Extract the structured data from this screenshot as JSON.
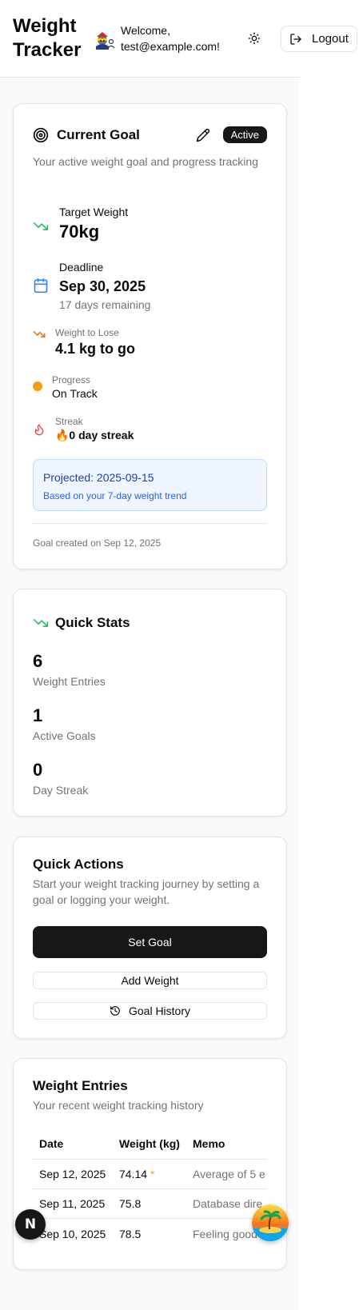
{
  "header": {
    "app_title": "Weight Tracker",
    "welcome_line1": "Welcome,",
    "welcome_line2": "test@example.com!",
    "logout_label": "Logout"
  },
  "current_goal": {
    "title": "Current Goal",
    "badge": "Active",
    "description": "Your active weight goal and progress tracking",
    "target_label": "Target Weight",
    "target_value": "70kg",
    "deadline_label": "Deadline",
    "deadline_value": "Sep 30, 2025",
    "days_remaining": "17 days remaining",
    "to_lose_label": "Weight to Lose",
    "to_lose_value": "4.1 kg to go",
    "progress_label": "Progress",
    "progress_value": "On Track",
    "streak_label": "Streak",
    "streak_value": "🔥0 day streak",
    "projection_title": "Projected: 2025-09-15",
    "projection_note": "Based on your 7-day weight trend",
    "created_note": "Goal created on Sep 12, 2025"
  },
  "quick_stats": {
    "title": "Quick Stats",
    "stats": [
      {
        "value": "6",
        "label": "Weight Entries"
      },
      {
        "value": "1",
        "label": "Active Goals"
      },
      {
        "value": "0",
        "label": "Day Streak"
      }
    ]
  },
  "quick_actions": {
    "title": "Quick Actions",
    "description": "Start your weight tracking journey by setting a goal or logging your weight.",
    "set_goal": "Set Goal",
    "add_weight": "Add Weight",
    "goal_history": "Goal History"
  },
  "weight_entries": {
    "title": "Weight Entries",
    "description": "Your recent weight tracking history",
    "columns": [
      "Date",
      "Weight (kg)",
      "Memo"
    ],
    "rows": [
      {
        "date": "Sep 12, 2025",
        "weight": "74.14",
        "marker": "*",
        "memo": "Average of 5 e"
      },
      {
        "date": "Sep 11, 2025",
        "weight": "75.8",
        "marker": "",
        "memo": "Database dire"
      },
      {
        "date": "Sep 10, 2025",
        "weight": "78.5",
        "marker": "",
        "memo": "Feeling good"
      }
    ]
  },
  "next_badge_letter": "N",
  "colors": {
    "green": "#22c55e",
    "orange": "#f97316",
    "amber": "#f59e0b",
    "red": "#ef4444",
    "blue": "#3b82f6",
    "dark": "#171717"
  }
}
